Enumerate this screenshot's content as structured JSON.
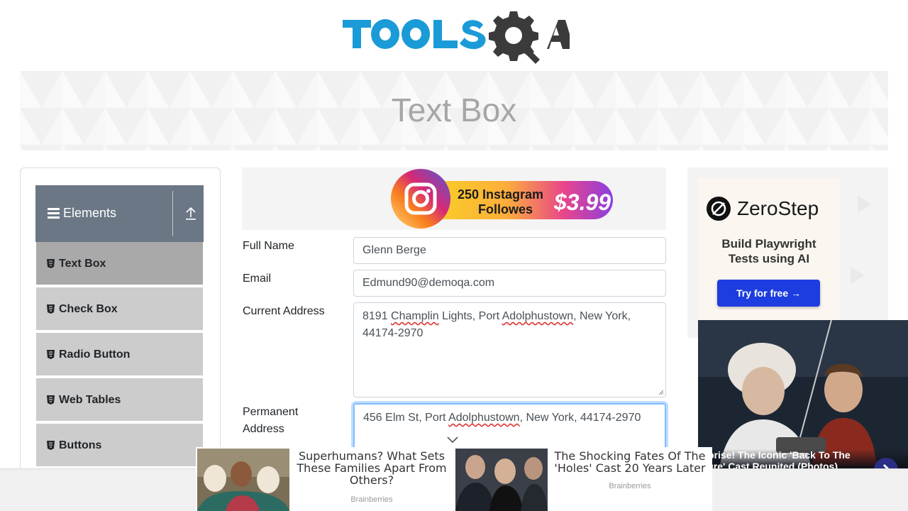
{
  "header": {
    "logo_text": "TOOLSQA"
  },
  "banner": {
    "title": "Text Box"
  },
  "sidebar": {
    "group_title": "Elements",
    "items": [
      {
        "label": "Text Box",
        "active": true
      },
      {
        "label": "Check Box",
        "active": false
      },
      {
        "label": "Radio Button",
        "active": false
      },
      {
        "label": "Web Tables",
        "active": false
      },
      {
        "label": "Buttons",
        "active": false
      }
    ]
  },
  "top_ad": {
    "line1": "250 Instagram",
    "line2": "Followes",
    "price": "$3.99"
  },
  "form": {
    "full_name": {
      "label": "Full Name",
      "value": "Glenn Berge"
    },
    "email": {
      "label": "Email",
      "value": "Edmund90@demoqa.com"
    },
    "current_address": {
      "label": "Current Address",
      "value_parts": [
        "8191 ",
        "Champlin",
        " Lights, Port ",
        "Adolphustown",
        ", New York,",
        "44174-2970"
      ]
    },
    "permanent_address": {
      "label_line1": "Permanent",
      "label_line2": "Address",
      "value_parts": [
        "456 Elm St, Port ",
        "Adolphustown",
        ", New York, 44174-2970"
      ]
    }
  },
  "right_ad": {
    "brand": "ZeroStep",
    "tagline_line1": "Build Playwright",
    "tagline_line2": "Tests using AI",
    "cta": "Try for free →"
  },
  "video": {
    "caption_line1": "urprise! The Iconic 'Back To The",
    "caption_line2": "uture' Cast Reunited (Photos)"
  },
  "bottom_ads": [
    {
      "title": "Superhumans? What Sets These Families Apart From Others?",
      "source": "Brainberries"
    },
    {
      "title": "The Shocking Fates Of The 'Holes' Cast 20 Years Later",
      "source": "Brainberries"
    }
  ],
  "colors": {
    "accent": "#1a9bd7",
    "sidebar_header": "#6b7785",
    "sidebar_item": "#cccccc",
    "sidebar_active": "#a9a9a9",
    "focus": "#80bdff"
  }
}
